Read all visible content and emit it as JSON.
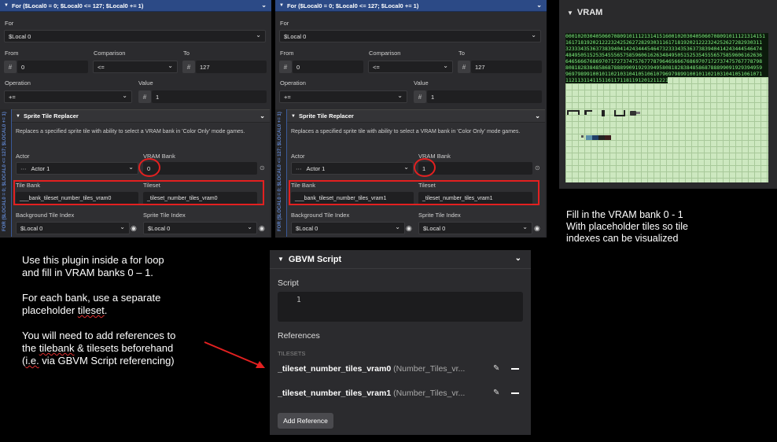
{
  "panels": [
    {
      "header": "For ($Local0 = 0; $Local0 <= 127; $Local0 += 1)",
      "for_label": "For",
      "for_value": "$Local 0",
      "from_label": "From",
      "from_value": "0",
      "comparison_label": "Comparison",
      "comparison_value": "<=",
      "to_label": "To",
      "to_value": "127",
      "operation_label": "Operation",
      "operation_value": "+=",
      "value_label": "Value",
      "value_value": "1",
      "side_text": "FOR ($LOCAL0 = 0; $LOCAL0 <= 127; $LOCAL0 += 1)",
      "sub_header": "Sprite Tile Replacer",
      "description": "Replaces a specified sprite tile with ability to select a VRAM bank in 'Color Only' mode games.",
      "actor_label": "Actor",
      "actor_value": "Actor 1",
      "vram_bank_label": "VRAM Bank",
      "vram_bank_value": "0",
      "tile_bank_label": "Tile Bank",
      "tile_bank_value": "___bank_tileset_number_tiles_vram0",
      "tileset_label": "Tileset",
      "tileset_value": "_tileset_number_tiles_vram0",
      "bg_tile_label": "Background Tile Index",
      "bg_tile_value": "$Local 0",
      "sprite_tile_label": "Sprite Tile Index",
      "sprite_tile_value": "$Local 0"
    },
    {
      "header": "For ($Local0 = 0; $Local0 <= 127; $Local0 += 1)",
      "for_label": "For",
      "for_value": "$Local 0",
      "from_label": "From",
      "from_value": "0",
      "comparison_label": "Comparison",
      "comparison_value": "<=",
      "to_label": "To",
      "to_value": "127",
      "operation_label": "Operation",
      "operation_value": "+=",
      "value_label": "Value",
      "value_value": "1",
      "side_text": "FOR ($LOCAL0 = 0; $LOCAL0 <= 127; $LOCAL0 += 1)",
      "sub_header": "Sprite Tile Replacer",
      "description": "Replaces a specified sprite tile with ability to select a VRAM bank in 'Color Only' mode games.",
      "actor_label": "Actor",
      "actor_value": "Actor 1",
      "vram_bank_label": "VRAM Bank",
      "vram_bank_value": "1",
      "tile_bank_label": "Tile Bank",
      "tile_bank_value": "___bank_tileset_number_tiles_vram1",
      "tileset_label": "Tileset",
      "tileset_value": "_tileset_number_tiles_vram1",
      "bg_tile_label": "Background Tile Index",
      "bg_tile_value": "$Local 0",
      "sprite_tile_label": "Sprite Tile Index",
      "sprite_tile_value": "$Local 0"
    }
  ],
  "vram": {
    "title": "VRAM",
    "rows": [
      "000102030405060708091011121314151600102030405060708091011121314151",
      "16171819202122232425262728293031161718192021222324252627282930311",
      "32333435363738394041424344454647323334353637383940414243444546474",
      "48495051525354555657585960616263484950515253545556575859606162636",
      "64656667686970717273747576777879646566676869707172737475767778798",
      "80818283848586878889909192939495808182838485868788899091929394959",
      "96979899100101102103104105106107969798991001011021031041051061071",
      "112113114115116117118119120121122123124125126127112113114115116117"
    ]
  },
  "notes": {
    "vram_note_1": "Fill in the VRAM bank 0 - 1",
    "vram_note_2": "With placeholder tiles so tile",
    "vram_note_3": "indexes can be visualized",
    "main_1a": "Use this plugin inside a for loop",
    "main_1b": "and fill in VRAM banks 0 – 1.",
    "main_2a": "For each bank, use a separate",
    "main_2b_pre": "placeholder ",
    "main_2b_squig": "tileset",
    "main_2b_post": ".",
    "main_3a": "You will need to add references to",
    "main_3b_pre": "the ",
    "main_3b_squig": "tilebank",
    "main_3b_post": " & tilesets beforehand",
    "main_3c_pre": "(",
    "main_3c_squig": "i.e.",
    "main_3c_post": " via GBVM Script referencing)"
  },
  "gbvm": {
    "title": "GBVM Script",
    "script_label": "Script",
    "line_number": "1",
    "references_label": "References",
    "tilesets_label": "TILESETS",
    "refs": [
      {
        "name": "_tileset_number_tiles_vram0",
        "detail": "(Number_Tiles_vr..."
      },
      {
        "name": "_tileset_number_tiles_vram1",
        "detail": "(Number_Tiles_vr..."
      }
    ],
    "add_reference": "Add Reference"
  },
  "colors": {
    "header_blue": "#2c4a86",
    "highlight_red": "#e32020",
    "vram_green": "#cde8c0"
  }
}
